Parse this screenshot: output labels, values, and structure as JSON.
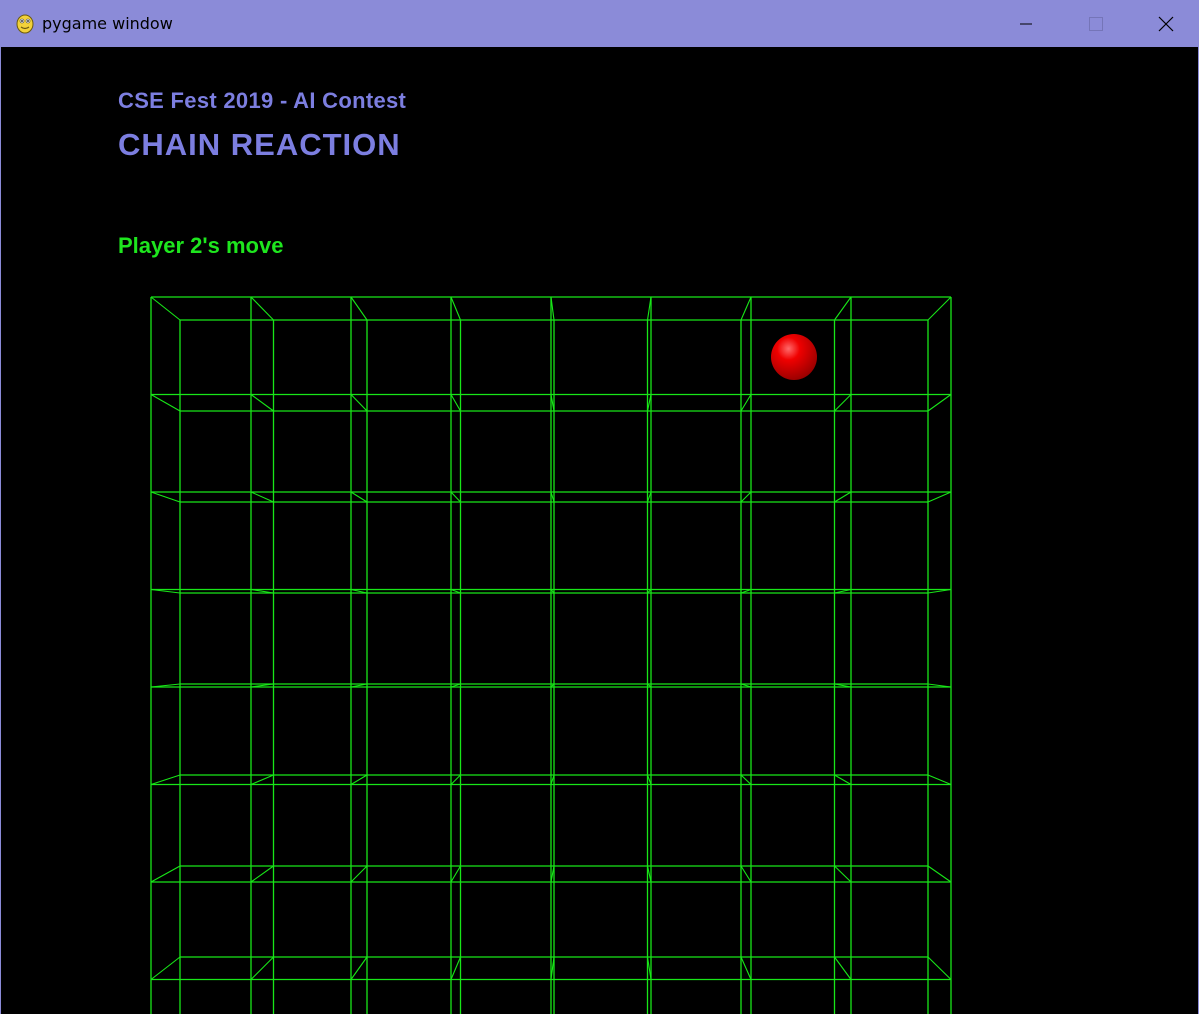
{
  "window": {
    "title": "pygame window",
    "app_icon": "pygame-snake-icon",
    "controls": {
      "minimize_icon": "minimize-icon",
      "maximize_icon": "maximize-icon",
      "close_icon": "close-icon"
    }
  },
  "header": {
    "contest_title": "CSE Fest 2019 - AI Contest",
    "game_title": "CHAIN REACTION"
  },
  "status": {
    "turn_text": "Player 2's move"
  },
  "board": {
    "columns": 8,
    "visible_rows": 7,
    "grid_color": "#18e618",
    "orbs": [
      {
        "row": 0,
        "col": 6,
        "count": 1,
        "player": 2,
        "color": "#e00000"
      }
    ]
  },
  "colors": {
    "titlebar": "#8b8bd8",
    "title_text": "#7c7ee0",
    "turn_text": "#1ee61e",
    "background": "#000000"
  }
}
